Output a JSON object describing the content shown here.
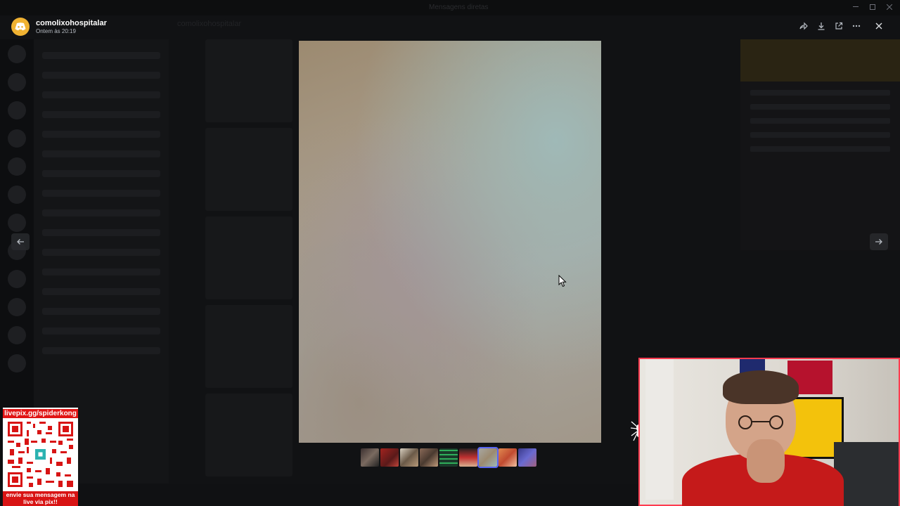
{
  "background_app": {
    "window_title": "Mensagens diretas",
    "chat_header": "comolixohospitalar"
  },
  "viewer": {
    "author": "comolixohospitalar",
    "timestamp": "Ontem às 20:19",
    "toolbar": {
      "forward_icon": "forward-icon",
      "download_icon": "download-icon",
      "open_external_icon": "open-external-icon",
      "more_icon": "more-icon",
      "close_icon": "close-icon"
    },
    "thumbnail_count": 9,
    "active_thumbnail": 6
  },
  "overlay": {
    "qr_url": "livepix.gg/spiderkong",
    "qr_caption": "envie sua mensagem na live via pix!!"
  },
  "colors": {
    "accent": "#5865f2",
    "brand_orange": "#f0b232",
    "overlay_red": "#e11515",
    "webcam_border": "#ff3b4f"
  }
}
